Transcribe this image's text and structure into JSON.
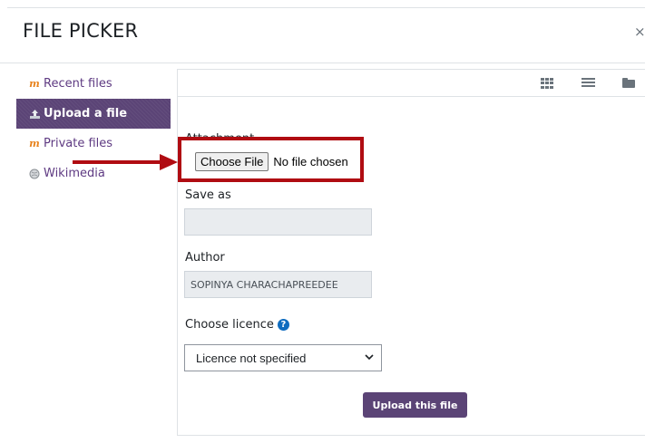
{
  "dialog": {
    "title": "FILE PICKER",
    "close_glyph": "×"
  },
  "sidebar": {
    "items": [
      {
        "label": "Recent files",
        "icon": "moodle-icon",
        "active": false
      },
      {
        "label": "Upload a file",
        "icon": "upload-icon",
        "active": true
      },
      {
        "label": "Private files",
        "icon": "moodle-icon",
        "active": false
      },
      {
        "label": "Wikimedia",
        "icon": "wikimedia-icon",
        "active": false
      }
    ]
  },
  "toolbar": {
    "icons": [
      "grid-view-icon",
      "list-view-icon",
      "folder-view-icon"
    ]
  },
  "form": {
    "attachment_label": "Attachment",
    "choose_file_label": "Choose File",
    "no_file_text": "No file chosen",
    "save_as_label": "Save as",
    "save_as_value": "",
    "author_label": "Author",
    "author_value": "SOPINYA CHARACHAPREEDEE",
    "licence_label": "Choose licence",
    "licence_value": "Licence not specified",
    "upload_button": "Upload this file"
  },
  "colors": {
    "accent": "#5b4476",
    "highlight_box": "#b00c12",
    "arrow": "#b00c12",
    "help_icon": "#0f6cbf"
  }
}
